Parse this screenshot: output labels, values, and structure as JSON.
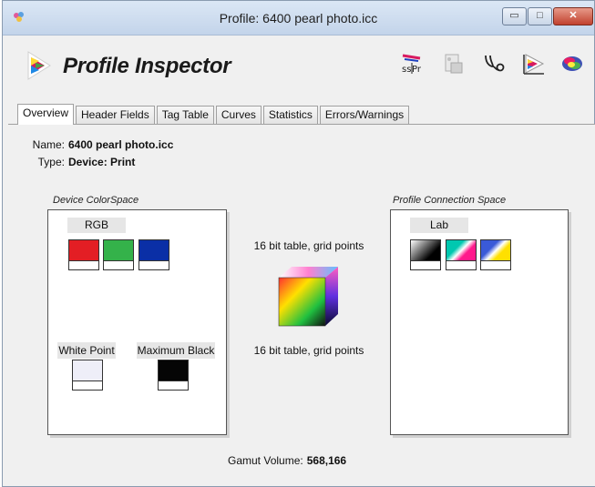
{
  "window": {
    "title": "Profile: 6400 pearl photo.icc",
    "buttons": {
      "minimize": "▭",
      "maximize": "□",
      "close": "✕"
    }
  },
  "app": {
    "title": "Profile Inspector",
    "toolbar_icons": [
      "sspr-icon",
      "profile-document-icon",
      "stethoscope-icon",
      "gamut-triangle-icon",
      "color-cloud-icon"
    ]
  },
  "tabs": [
    "Overview",
    "Header Fields",
    "Tag Table",
    "Curves",
    "Statistics",
    "Errors/Warnings"
  ],
  "active_tab": "Overview",
  "overview": {
    "name_label": "Name:",
    "name_value": "6400 pearl photo.icc",
    "type_label": "Type:",
    "type_value": "Device: Print",
    "device_colorspace": {
      "group_label": "Device ColorSpace",
      "space": "RGB",
      "channel_colors": [
        "#e31e24",
        "#34b24a",
        "#0a2fa6"
      ],
      "white_point_label": "White Point",
      "white_point_color": "#eeeef8",
      "max_black_label": "Maximum Black",
      "max_black_color": "#050505"
    },
    "a2b_text": "16 bit table,  grid points",
    "b2a_text": "16 bit table,  grid points",
    "pcs": {
      "group_label": "Profile Connection Space",
      "space": "Lab"
    },
    "gamut_label": "Gamut Volume:",
    "gamut_value": "568,166"
  }
}
